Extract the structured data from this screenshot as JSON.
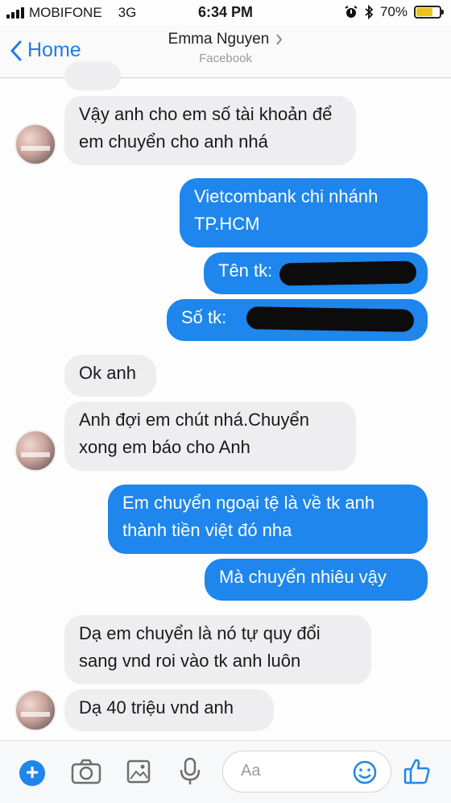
{
  "status_bar": {
    "carrier": "MOBIFONE",
    "network": "3G",
    "time": "6:34 PM",
    "battery": "70%",
    "battery_level": 0.7
  },
  "nav": {
    "back_label": "Home",
    "contact_name": "Emma Nguyen",
    "contact_source": "Facebook"
  },
  "messages": [
    {
      "side": "in",
      "text": "Vậy anh cho em số tài khoản để em chuyển cho anh nhá"
    },
    {
      "side": "out",
      "text": "Vietcombank chi nhánh TP.HCM"
    },
    {
      "side": "out",
      "text": "Tên tk:"
    },
    {
      "side": "out",
      "text": "Số tk:"
    },
    {
      "side": "in",
      "text": "Ok anh"
    },
    {
      "side": "in",
      "text": "Anh đợi em chút nhá.Chuyển xong em báo cho Anh"
    },
    {
      "side": "out",
      "text": "Em chuyển ngoại tệ là về tk anh thành tiền việt đó nha"
    },
    {
      "side": "out",
      "text": "Mà chuyển nhiêu vậy"
    },
    {
      "side": "in",
      "text": "Dạ em chuyển là nó tự quy đổi sang vnd roi vào tk anh luôn"
    },
    {
      "side": "in",
      "text": "Dạ 40 triệu vnd anh"
    }
  ],
  "composer": {
    "placeholder": "Aa"
  },
  "colors": {
    "accent": "#1e86ec",
    "incoming_bubble": "#eeeef0",
    "battery": "#e9c21a"
  },
  "icons": {
    "back": "chevron-left-icon",
    "add": "plus-icon",
    "camera": "camera-icon",
    "gallery": "image-icon",
    "mic": "microphone-icon",
    "emoji": "smiley-icon",
    "like": "thumbs-up-icon"
  }
}
